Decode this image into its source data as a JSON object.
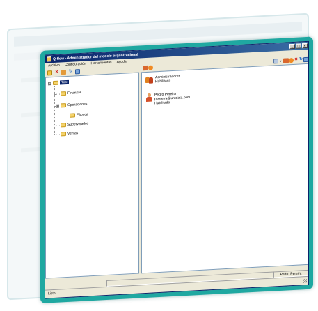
{
  "window": {
    "title": "Q-flow - Administrador del modelo organizacional",
    "buttons": [
      "_",
      "□",
      "×"
    ]
  },
  "menu": [
    "Archivo",
    "Configuración",
    "Herramientas",
    "Ayuda"
  ],
  "toolbar_left_icons": [
    "new-folder-icon",
    "delete-icon",
    "edit-icon",
    "refresh-icon",
    "properties-icon"
  ],
  "toolbar_right_icons": [
    "view-options-icon",
    "dropdown-icon",
    "add-group-icon",
    "add-user-icon",
    "delete-icon",
    "refresh-icon",
    "properties-icon"
  ],
  "tree": {
    "root": "Root",
    "children": [
      "Finanzas",
      "Operaciones",
      "Fábrica",
      "Supervisados",
      "Ventas"
    ],
    "expander_root": "⊟",
    "expander_ops": "⊞"
  },
  "list": [
    {
      "type": "group",
      "name": "Administradores",
      "status": "Habilitado"
    },
    {
      "type": "user",
      "name": "Pedro Pereira",
      "email": "ppereira@urudata.com",
      "status": "Habilitado"
    }
  ],
  "status": {
    "user": "Pedro Pereira",
    "text": "Listo"
  },
  "colors": {
    "frame": "#1fa8a1",
    "titlebar": "#0a246a",
    "window_bg": "#ece9d8"
  }
}
